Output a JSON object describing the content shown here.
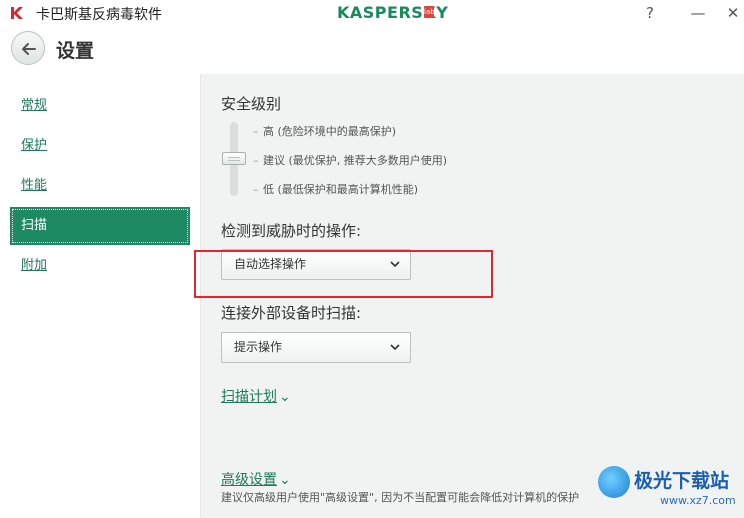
{
  "window": {
    "title": "卡巴斯基反病毒软件",
    "brand": "KASPERSKY",
    "brand_badge": "lab",
    "help_label": "?",
    "minimize_label": "—",
    "close_label": "✕"
  },
  "header": {
    "title": "设置"
  },
  "sidebar": {
    "items": [
      {
        "label": "常规"
      },
      {
        "label": "保护"
      },
      {
        "label": "性能"
      },
      {
        "label": "扫描",
        "active": true
      },
      {
        "label": "附加"
      }
    ]
  },
  "main": {
    "security_level": {
      "label": "安全级别",
      "levels": [
        "高 (危险环境中的最高保护)",
        "建议 (最优保护, 推荐大多数用户使用)",
        "低 (最低保护和最高计算机性能)"
      ],
      "selected_index": 1
    },
    "threat_action": {
      "label": "检测到威胁时的操作:",
      "value": "自动选择操作"
    },
    "external_scan": {
      "label": "连接外部设备时扫描:",
      "value": "提示操作"
    },
    "scan_schedule_link": "扫描计划",
    "advanced_link": "高级设置",
    "advanced_note": "建议仅高级用户使用\"高级设置\", 因为不当配置可能会降低对计算机的保护"
  },
  "watermark": {
    "name": "极光下载站",
    "url": "www.xz7.com"
  },
  "colors": {
    "accent": "#1d8a63",
    "link": "#1d7a5a",
    "highlight": "#e0282e",
    "main_bg": "#f0f3f2"
  }
}
